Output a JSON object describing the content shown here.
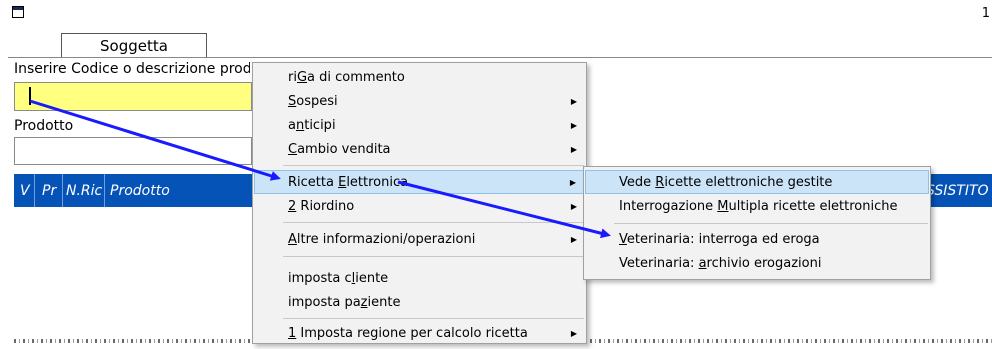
{
  "window": {
    "corner_number": "1"
  },
  "tab": {
    "label": "Soggetta"
  },
  "form": {
    "code_label": "Inserire Codice o descrizione prodotto",
    "code_value": "",
    "product_label": "Prodotto",
    "product_value": ""
  },
  "grid": {
    "headers": [
      "V",
      "Pr",
      "N.Ric",
      "Prodotto"
    ],
    "right_header": "SSISTITO",
    "header_color": "#0553b6"
  },
  "context_menu": {
    "items": [
      {
        "pre": "ri",
        "key": "G",
        "post": "a di commento",
        "submenu": false
      },
      {
        "pre": "",
        "key": "S",
        "post": "ospesi",
        "submenu": true
      },
      {
        "pre": "a",
        "key": "n",
        "post": "ticipi",
        "submenu": true
      },
      {
        "pre": "",
        "key": "C",
        "post": "ambio vendita",
        "submenu": true
      },
      {
        "pre": "Ricetta ",
        "key": "E",
        "post": "lettronica",
        "submenu": true,
        "highlighted": true
      },
      {
        "pre": "",
        "key": "2",
        "post": " Riordino",
        "submenu": true
      },
      {
        "pre": "",
        "key": "A",
        "post": "ltre informazioni/operazioni",
        "submenu": true
      },
      {
        "pre": "imposta c",
        "key": "l",
        "post": "iente",
        "submenu": false
      },
      {
        "pre": "imposta pa",
        "key": "z",
        "post": "iente",
        "submenu": false
      },
      {
        "pre": "",
        "key": "1",
        "post": " Imposta regione per calcolo ricetta",
        "submenu": true
      }
    ]
  },
  "submenu": {
    "items": [
      {
        "pre": "Vede ",
        "key": "R",
        "post": "icette elettroniche gestite",
        "highlighted": true
      },
      {
        "pre": "Interrogazione ",
        "key": "M",
        "post": "ultipla ricette elettroniche"
      },
      {
        "pre": "",
        "key": "V",
        "post": "eterinaria: interroga ed eroga"
      },
      {
        "pre": "Veterinaria: ",
        "key": "a",
        "post": "rchivio erogazioni"
      }
    ]
  },
  "accent_colors": {
    "highlight": "#cce4f7",
    "arrow": "#1a1aff",
    "field_yellow": "#ffff80"
  }
}
